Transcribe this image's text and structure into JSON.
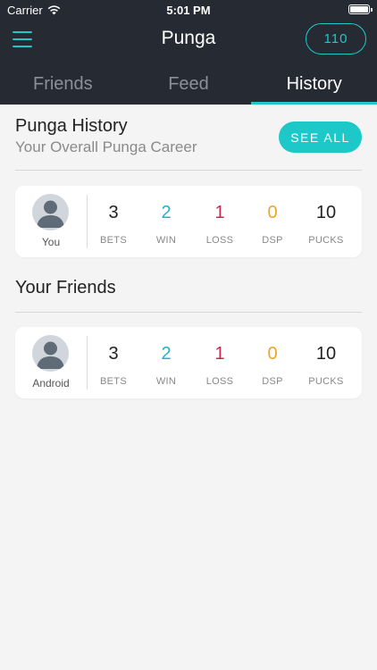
{
  "status_bar": {
    "carrier": "Carrier",
    "time": "5:01 PM"
  },
  "header": {
    "title": "Punga",
    "pucks": "110"
  },
  "tabs": [
    {
      "label": "Friends",
      "active": false
    },
    {
      "label": "Feed",
      "active": false
    },
    {
      "label": "History",
      "active": true
    }
  ],
  "history": {
    "title": "Punga History",
    "subtitle": "Your Overall Punga Career",
    "see_all": "SEE ALL"
  },
  "my_stats": {
    "user": "You",
    "bets": "3",
    "win": "2",
    "loss": "1",
    "dsp": "0",
    "pucks": "10"
  },
  "friends_section": {
    "title": "Your Friends"
  },
  "friend_stats": {
    "user": "Android",
    "bets": "3",
    "win": "2",
    "loss": "1",
    "dsp": "0",
    "pucks": "10"
  },
  "labels": {
    "bets": "BETS",
    "win": "WIN",
    "loss": "LOSS",
    "dsp": "DSP",
    "pucks": "PUCKS"
  },
  "colors": {
    "accent": "#1cc8c8",
    "win": "#1cb5c4",
    "loss": "#c8294f",
    "dsp": "#f0a32a",
    "header_bg": "#262b33"
  }
}
